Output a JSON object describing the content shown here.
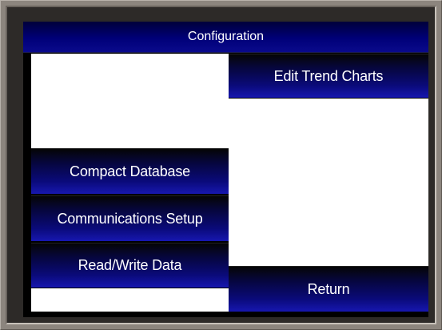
{
  "screen": {
    "title": "Configuration"
  },
  "buttons": {
    "edit_trend_charts": "Edit Trend Charts",
    "compact_database": "Compact Database",
    "communications_setup": "Communications Setup",
    "read_write_data": "Read/Write Data",
    "return": "Return"
  },
  "colors": {
    "bezel": "#8c857e",
    "title_bar": "#000078",
    "button_gradient_bottom": "#1717b0",
    "panel": "#ffffff"
  }
}
